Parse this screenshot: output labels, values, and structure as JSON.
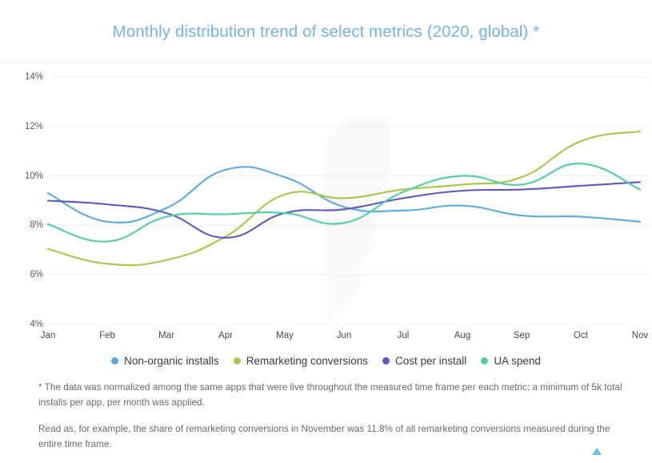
{
  "header": {
    "title": "Monthly distribution trend of select metrics (2020, global) *",
    "title_color": "#73b4e8"
  },
  "legend": {
    "items": [
      {
        "label": "Non-organic installs",
        "color": "#56ade6",
        "dot_name": "legend-dot-non-organic-installs"
      },
      {
        "label": "Remarketing conversions",
        "color": "#a6c93f",
        "dot_name": "legend-dot-remarketing-conversions"
      },
      {
        "label": "Cost per install",
        "color": "#5b58cc",
        "dot_name": "legend-dot-cost-per-install"
      },
      {
        "label": "UA spend",
        "color": "#4bd0a8",
        "dot_name": "legend-dot-ua-spend"
      }
    ]
  },
  "footnotes": {
    "note_1": "* The data was normalized among the same apps that were live throughout the measured time frame per each metric; a minimum of 5k total installs per app, per month was applied.",
    "note_2": "Read as, for example, the share of remarketing conversions in November was 11.8% of all remarketing conversions measured during the entire time frame."
  },
  "chart_data": {
    "type": "line",
    "title": "Monthly distribution trend of select metrics (2020, global) *",
    "xlabel": "",
    "ylabel": "",
    "categories": [
      "Jan",
      "Feb",
      "Mar",
      "Apr",
      "May",
      "Jun",
      "Jul",
      "Aug",
      "Sep",
      "Oct",
      "Nov"
    ],
    "ylim": [
      4,
      14
    ],
    "yticks": [
      4,
      6,
      8,
      10,
      12,
      14
    ],
    "ytick_labels": [
      "4%",
      "6%",
      "8%",
      "10%",
      "12%",
      "14%"
    ],
    "y_unit": "%",
    "grid": true,
    "legend_position": "bottom",
    "series": [
      {
        "name": "Non-organic installs",
        "color": "#56ade6",
        "values": [
          9.3,
          8.15,
          8.7,
          10.25,
          9.95,
          8.75,
          8.6,
          8.8,
          8.4,
          8.35,
          8.15
        ]
      },
      {
        "name": "Remarketing conversions",
        "color": "#a6c93f",
        "values": [
          7.05,
          6.45,
          6.6,
          7.55,
          9.25,
          9.1,
          9.45,
          9.65,
          9.95,
          11.4,
          11.8
        ]
      },
      {
        "name": "Cost per install",
        "color": "#5b58cc",
        "values": [
          9.0,
          8.85,
          8.5,
          7.5,
          8.5,
          8.65,
          9.1,
          9.4,
          9.45,
          9.6,
          9.75
        ]
      },
      {
        "name": "UA spend",
        "color": "#4bd0a8",
        "values": [
          8.05,
          7.35,
          8.35,
          8.45,
          8.5,
          8.1,
          9.35,
          10.0,
          9.65,
          10.5,
          9.45
        ]
      }
    ]
  }
}
